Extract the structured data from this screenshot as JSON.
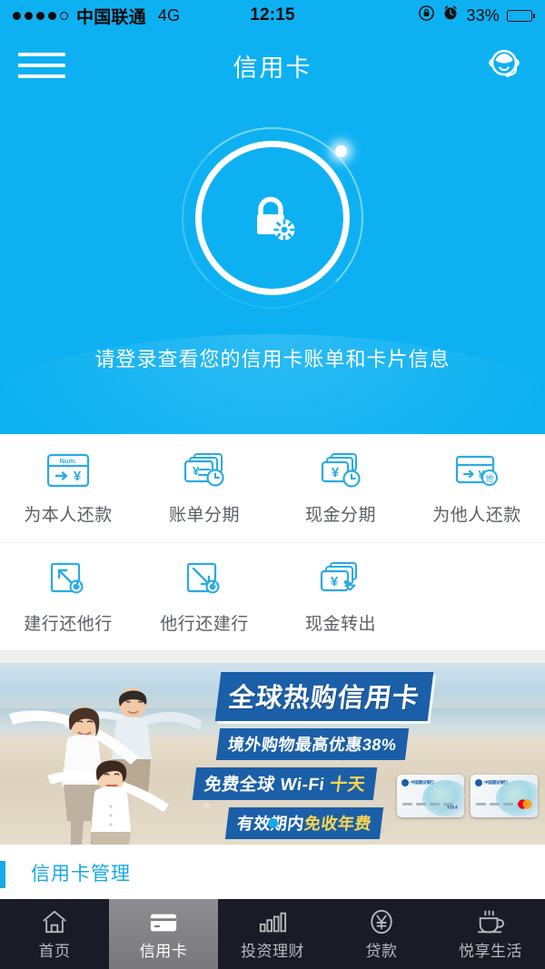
{
  "status_bar": {
    "carrier": "中国联通",
    "network": "4G",
    "time": "12:15",
    "battery_percent": "33%",
    "battery_level": 33,
    "signal_dots_filled": 4,
    "signal_dots_total": 5,
    "icons": [
      "rotation-lock-icon",
      "alarm-clock-icon",
      "battery-icon"
    ]
  },
  "nav": {
    "title": "信用卡",
    "menu_icon": "hamburger-menu-icon",
    "service_icon": "customer-service-icon"
  },
  "hero": {
    "lock_icon": "lock-gear-icon",
    "tip": "请登录查看您的信用卡账单和卡片信息",
    "background_color": "#0DB1F2"
  },
  "grid": {
    "row1": [
      {
        "label": "为本人还款",
        "icon": "card-num-yen-icon"
      },
      {
        "label": "账单分期",
        "icon": "cards-clock-icon"
      },
      {
        "label": "现金分期",
        "icon": "cash-clock-icon"
      },
      {
        "label": "为他人还款",
        "icon": "card-other-person-icon"
      }
    ],
    "row2": [
      {
        "label": "建行还他行",
        "icon": "arrow-out-refresh-icon"
      },
      {
        "label": "他行还建行",
        "icon": "arrow-in-refresh-icon"
      },
      {
        "label": "现金转出",
        "icon": "cash-transfer-out-icon"
      }
    ]
  },
  "banner": {
    "headline": "全球热购信用卡",
    "line2": "境外购物最高优惠38%",
    "line3_a": "免费全球 Wi-Fi ",
    "line3_b": "十天",
    "line4_a": "有效期内",
    "line4_b": "免收年费",
    "image_desc": "family-on-beach-photo",
    "card_brands": [
      "VISA",
      "MasterCard"
    ],
    "bank_name": "中国建设银行",
    "dots": 1,
    "active_dot": 0,
    "accent_color": "#1B5FA8",
    "highlight_color": "#FFD84D"
  },
  "next_section": {
    "title": "信用卡管理",
    "accent_color": "#16A9E8"
  },
  "tabbar": {
    "items": [
      {
        "label": "首页",
        "icon": "home-icon",
        "active": false
      },
      {
        "label": "信用卡",
        "icon": "card-icon",
        "active": true
      },
      {
        "label": "投资理财",
        "icon": "bar-chart-icon",
        "active": false
      },
      {
        "label": "贷款",
        "icon": "yen-circle-icon",
        "active": false
      },
      {
        "label": "悦享生活",
        "icon": "coffee-cup-icon",
        "active": false
      }
    ]
  }
}
